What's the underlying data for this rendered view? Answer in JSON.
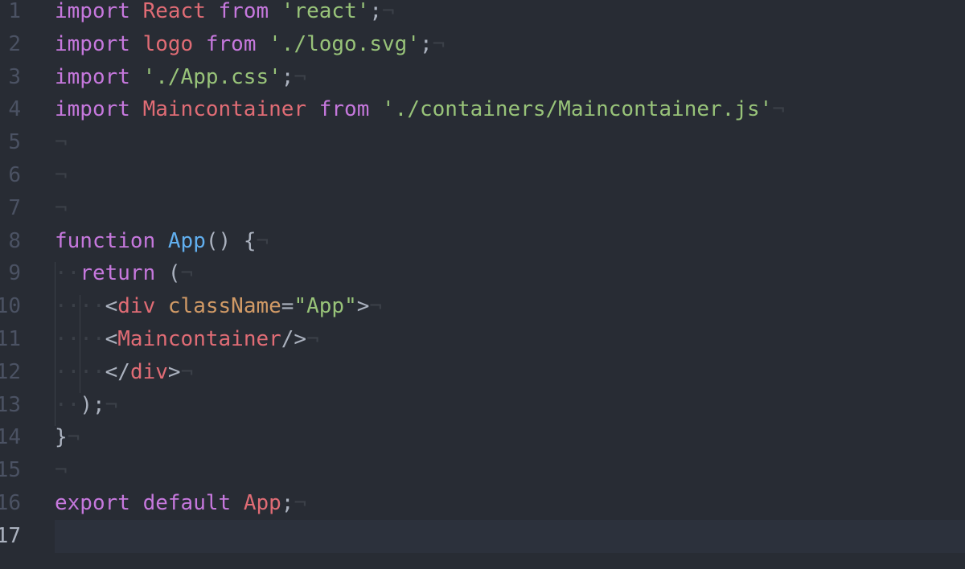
{
  "editor": {
    "line_numbers": [
      "1",
      "2",
      "3",
      "4",
      "5",
      "6",
      "7",
      "8",
      "9",
      "10",
      "11",
      "12",
      "13",
      "14",
      "15",
      "16",
      "17"
    ],
    "invisible_eol": "¬",
    "indent_dot": "·",
    "lines": [
      [
        {
          "t": "kw",
          "v": "import"
        },
        {
          "t": "punc",
          "v": " "
        },
        {
          "t": "id",
          "v": "React"
        },
        {
          "t": "punc",
          "v": " "
        },
        {
          "t": "kw",
          "v": "from"
        },
        {
          "t": "punc",
          "v": " "
        },
        {
          "t": "str",
          "v": "'react'"
        },
        {
          "t": "punc",
          "v": ";"
        }
      ],
      [
        {
          "t": "kw",
          "v": "import"
        },
        {
          "t": "punc",
          "v": " "
        },
        {
          "t": "id",
          "v": "logo"
        },
        {
          "t": "punc",
          "v": " "
        },
        {
          "t": "kw",
          "v": "from"
        },
        {
          "t": "punc",
          "v": " "
        },
        {
          "t": "str",
          "v": "'./logo.svg'"
        },
        {
          "t": "punc",
          "v": ";"
        }
      ],
      [
        {
          "t": "kw",
          "v": "import"
        },
        {
          "t": "punc",
          "v": " "
        },
        {
          "t": "str",
          "v": "'./App.css'"
        },
        {
          "t": "punc",
          "v": ";"
        }
      ],
      [
        {
          "t": "kw",
          "v": "import"
        },
        {
          "t": "punc",
          "v": " "
        },
        {
          "t": "id",
          "v": "Maincontainer"
        },
        {
          "t": "punc",
          "v": " "
        },
        {
          "t": "kw",
          "v": "from"
        },
        {
          "t": "punc",
          "v": " "
        },
        {
          "t": "str",
          "v": "'./containers/Maincontainer.js'"
        }
      ],
      [],
      [],
      [],
      [
        {
          "t": "kw",
          "v": "function"
        },
        {
          "t": "punc",
          "v": " "
        },
        {
          "t": "fn",
          "v": "App"
        },
        {
          "t": "punc",
          "v": "() {"
        }
      ],
      [
        {
          "t": "inv",
          "v": "··"
        },
        {
          "t": "kw",
          "v": "return"
        },
        {
          "t": "punc",
          "v": " ("
        }
      ],
      [
        {
          "t": "inv",
          "v": "····"
        },
        {
          "t": "punc",
          "v": "<"
        },
        {
          "t": "id",
          "v": "div"
        },
        {
          "t": "punc",
          "v": " "
        },
        {
          "t": "attr",
          "v": "className"
        },
        {
          "t": "punc",
          "v": "="
        },
        {
          "t": "str",
          "v": "\"App\""
        },
        {
          "t": "punc",
          "v": ">"
        }
      ],
      [
        {
          "t": "inv",
          "v": "····"
        },
        {
          "t": "punc",
          "v": "<"
        },
        {
          "t": "id",
          "v": "Maincontainer"
        },
        {
          "t": "punc",
          "v": "/>"
        }
      ],
      [
        {
          "t": "inv",
          "v": "····"
        },
        {
          "t": "punc",
          "v": "</"
        },
        {
          "t": "id",
          "v": "div"
        },
        {
          "t": "punc",
          "v": ">"
        }
      ],
      [
        {
          "t": "inv",
          "v": "··"
        },
        {
          "t": "punc",
          "v": ");"
        }
      ],
      [
        {
          "t": "punc",
          "v": "}"
        }
      ],
      [],
      [
        {
          "t": "kw",
          "v": "export"
        },
        {
          "t": "punc",
          "v": " "
        },
        {
          "t": "kw",
          "v": "default"
        },
        {
          "t": "punc",
          "v": " "
        },
        {
          "t": "id",
          "v": "App"
        },
        {
          "t": "punc",
          "v": ";"
        }
      ],
      []
    ],
    "active_line": 17,
    "colors": {
      "background": "#282c34",
      "cursor_line": "#2c313c",
      "keyword": "#c678dd",
      "identifier": "#e06c75",
      "string": "#98c379",
      "function": "#61afef",
      "attribute": "#d19a66",
      "punctuation": "#abb2bf",
      "line_number": "#4b5263",
      "invisible": "#3b4048"
    }
  }
}
